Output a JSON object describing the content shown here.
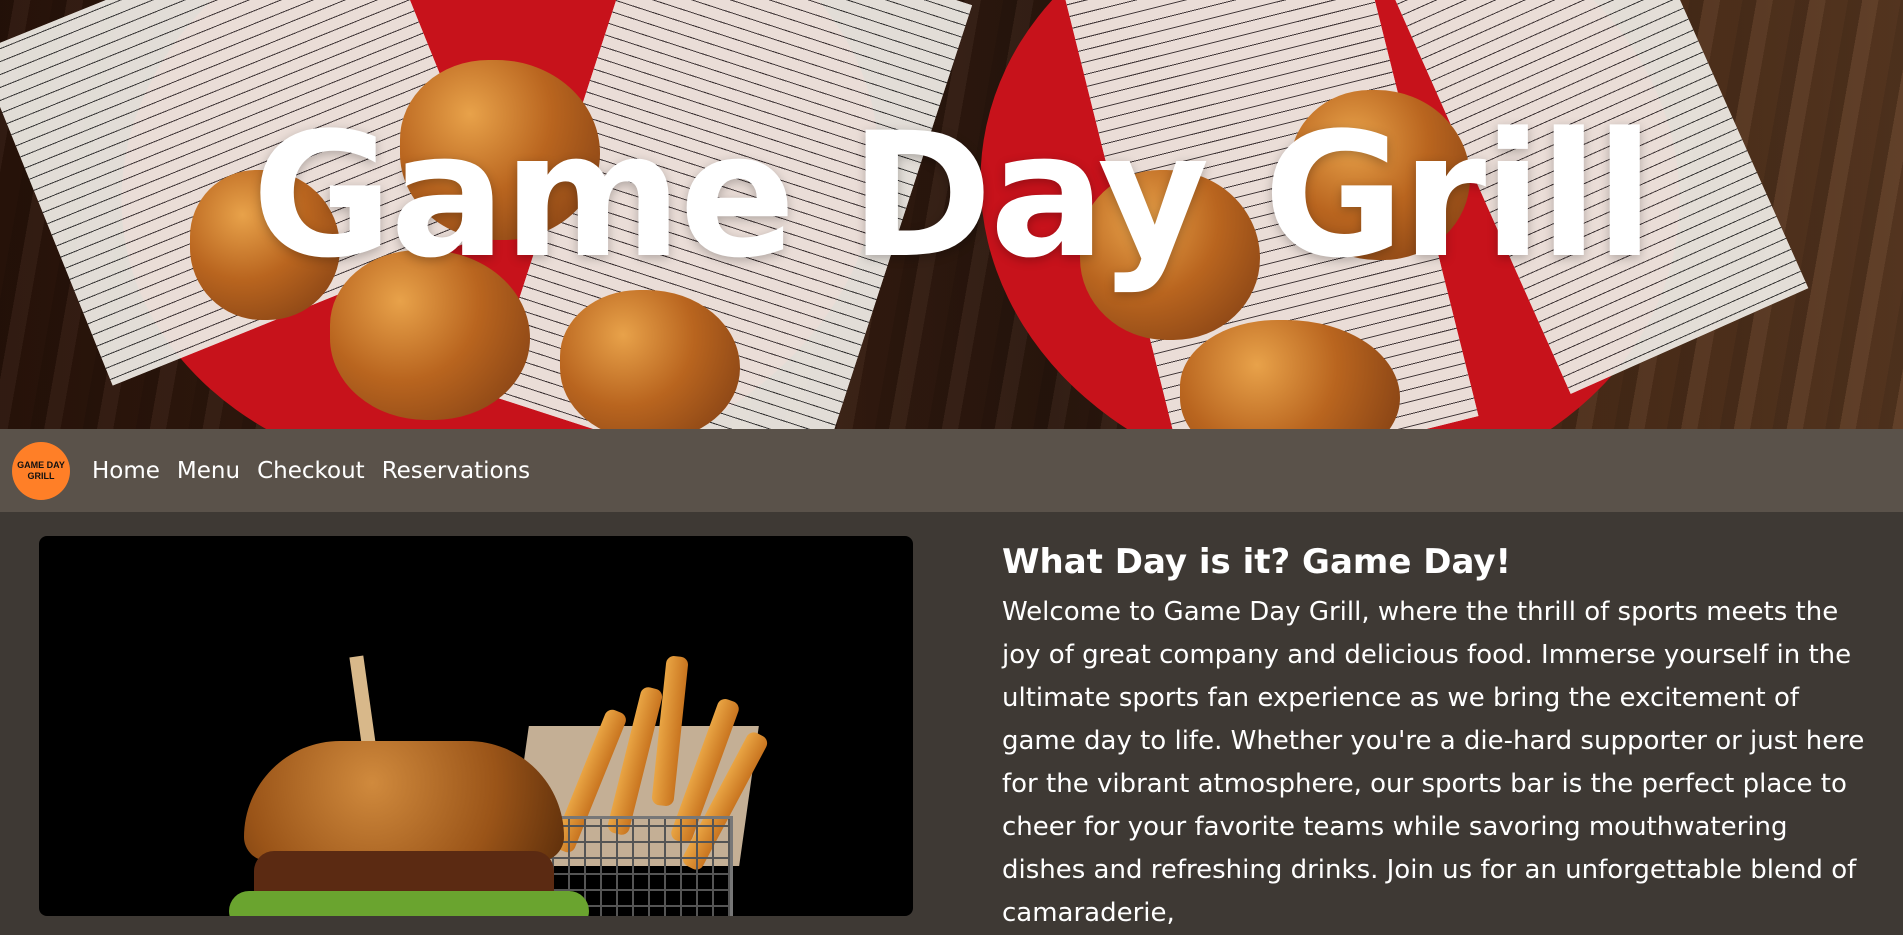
{
  "hero": {
    "title": "Game Day Grill"
  },
  "navbar": {
    "logo_text": "GAME DAY GRILL",
    "links": [
      "Home",
      "Menu",
      "Checkout",
      "Reservations"
    ]
  },
  "main": {
    "heading": "What Day is it? Game Day!",
    "paragraph": "Welcome to Game Day Grill, where the thrill of sports meets the joy of great company and delicious food. Immerse yourself in the ultimate sports fan experience as we bring the excitement of game day to life. Whether you're a die-hard supporter or just here for the vibrant atmosphere, our sports bar is the perfect place to cheer for your favorite teams while savoring mouthwatering dishes and refreshing drinks. Join us for an unforgettable blend of camaraderie,"
  },
  "colors": {
    "navbar_bg": "#5a524a",
    "page_bg": "#3e3934",
    "logo_bg": "#ff7f27"
  }
}
